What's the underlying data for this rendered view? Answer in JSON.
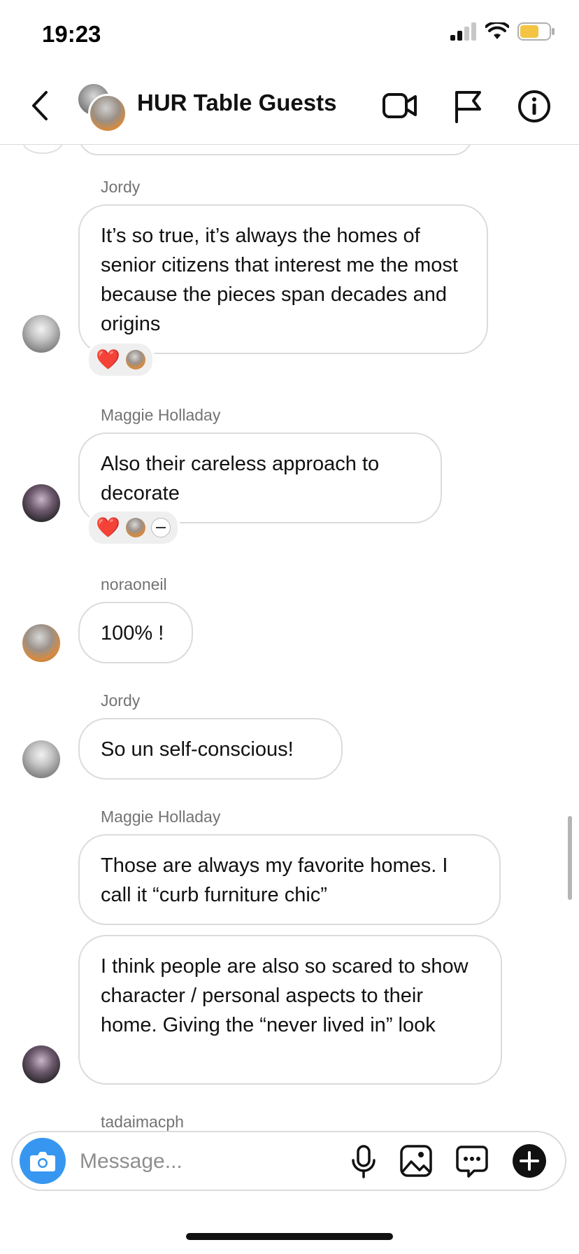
{
  "status_bar": {
    "time": "19:23"
  },
  "header": {
    "title": "HUR Table Guests"
  },
  "messages": [
    {
      "sender": "Jordy",
      "text": "It’s so true, it’s always the homes of senior citizens that interest me the most because the pieces span decades and origins",
      "reaction": "❤️"
    },
    {
      "sender": "Maggie Holladay",
      "text": "Also their careless approach to decorate",
      "reaction": "❤️"
    },
    {
      "sender": "noraoneil",
      "text": "100% !"
    },
    {
      "sender": "Jordy",
      "text": "So un self-conscious!"
    },
    {
      "sender": "Maggie Holladay",
      "text": "Those are always my favorite homes. I call it “curb furniture chic”"
    },
    {
      "sender": "",
      "text": "I think people are also so scared to show character / personal aspects to their home. Giving the “never lived in” look"
    },
    {
      "sender": "tadaimacph",
      "text": ""
    }
  ],
  "composer": {
    "placeholder": "Message..."
  },
  "icons": {
    "back": "chevron-left-icon",
    "video": "video-camera-icon",
    "flag": "flag-icon",
    "info": "info-icon",
    "camera": "camera-icon",
    "mic": "microphone-icon",
    "gallery": "image-icon",
    "sticker": "chat-bubble-icon",
    "add": "plus-icon"
  },
  "colors": {
    "accent": "#3797f0",
    "bubble_border": "#dbdbdb",
    "sender_text": "#737373",
    "heart": "#e0245e"
  }
}
